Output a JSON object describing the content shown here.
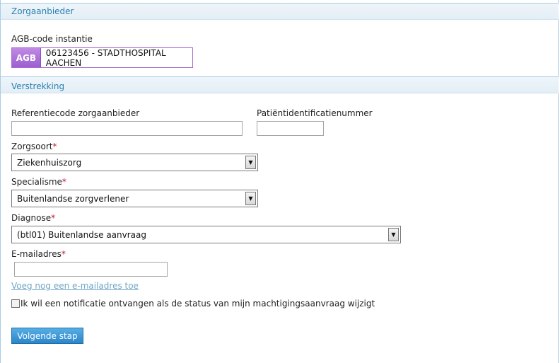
{
  "provider_section": {
    "title": "Zorgaanbieder",
    "agb_label": "AGB-code instantie",
    "agb_badge": "AGB",
    "agb_value": "06123456 - STADTHOSPITAL AACHEN"
  },
  "supply_section": {
    "title": "Verstrekking",
    "reference_label": "Referentiecode zorgaanbieder",
    "reference_value": "",
    "patient_id_label": "Patiëntidentificatienummer",
    "patient_id_value": "",
    "care_type_label": "Zorgsoort",
    "care_type_value": "Ziekenhuiszorg",
    "specialism_label": "Specialisme",
    "specialism_value": "Buitenlandse zorgverlener",
    "diagnosis_label": "Diagnose",
    "diagnosis_value": "(btl01) Buitenlandse aanvraag",
    "email_label": "E-mailadres",
    "email_value": "",
    "required_mark": "*",
    "add_email_link": "Voeg nog een e-mailadres toe",
    "notification_checkbox_label": "Ik wil een notificatie ontvangen als de status van mijn machtigingsaanvraag wijzigt",
    "notification_checked": false,
    "next_button": "Volgende stap"
  }
}
